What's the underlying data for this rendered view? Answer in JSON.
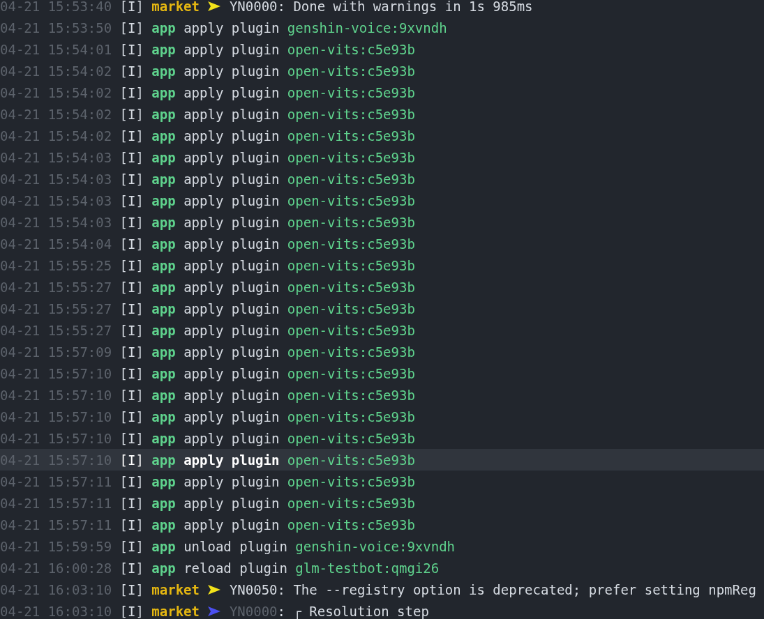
{
  "log": [
    {
      "kind": "market",
      "time": "04-21 15:53:40",
      "level": "[I]",
      "module": "market",
      "color": "#f2e21a",
      "code_muted": false,
      "code": "YN0000",
      "message": ": Done with warnings in 1s 985ms",
      "selected": false
    },
    {
      "kind": "plugin",
      "time": "04-21 15:53:50",
      "level": "[I]",
      "module": "app",
      "action": "apply plugin",
      "plugin": "genshin-voice:9xvndh",
      "selected": false
    },
    {
      "kind": "plugin",
      "time": "04-21 15:54:01",
      "level": "[I]",
      "module": "app",
      "action": "apply plugin",
      "plugin": "open-vits:c5e93b",
      "selected": false
    },
    {
      "kind": "plugin",
      "time": "04-21 15:54:02",
      "level": "[I]",
      "module": "app",
      "action": "apply plugin",
      "plugin": "open-vits:c5e93b",
      "selected": false
    },
    {
      "kind": "plugin",
      "time": "04-21 15:54:02",
      "level": "[I]",
      "module": "app",
      "action": "apply plugin",
      "plugin": "open-vits:c5e93b",
      "selected": false
    },
    {
      "kind": "plugin",
      "time": "04-21 15:54:02",
      "level": "[I]",
      "module": "app",
      "action": "apply plugin",
      "plugin": "open-vits:c5e93b",
      "selected": false
    },
    {
      "kind": "plugin",
      "time": "04-21 15:54:02",
      "level": "[I]",
      "module": "app",
      "action": "apply plugin",
      "plugin": "open-vits:c5e93b",
      "selected": false
    },
    {
      "kind": "plugin",
      "time": "04-21 15:54:03",
      "level": "[I]",
      "module": "app",
      "action": "apply plugin",
      "plugin": "open-vits:c5e93b",
      "selected": false
    },
    {
      "kind": "plugin",
      "time": "04-21 15:54:03",
      "level": "[I]",
      "module": "app",
      "action": "apply plugin",
      "plugin": "open-vits:c5e93b",
      "selected": false
    },
    {
      "kind": "plugin",
      "time": "04-21 15:54:03",
      "level": "[I]",
      "module": "app",
      "action": "apply plugin",
      "plugin": "open-vits:c5e93b",
      "selected": false
    },
    {
      "kind": "plugin",
      "time": "04-21 15:54:03",
      "level": "[I]",
      "module": "app",
      "action": "apply plugin",
      "plugin": "open-vits:c5e93b",
      "selected": false
    },
    {
      "kind": "plugin",
      "time": "04-21 15:54:04",
      "level": "[I]",
      "module": "app",
      "action": "apply plugin",
      "plugin": "open-vits:c5e93b",
      "selected": false
    },
    {
      "kind": "plugin",
      "time": "04-21 15:55:25",
      "level": "[I]",
      "module": "app",
      "action": "apply plugin",
      "plugin": "open-vits:c5e93b",
      "selected": false
    },
    {
      "kind": "plugin",
      "time": "04-21 15:55:27",
      "level": "[I]",
      "module": "app",
      "action": "apply plugin",
      "plugin": "open-vits:c5e93b",
      "selected": false
    },
    {
      "kind": "plugin",
      "time": "04-21 15:55:27",
      "level": "[I]",
      "module": "app",
      "action": "apply plugin",
      "plugin": "open-vits:c5e93b",
      "selected": false
    },
    {
      "kind": "plugin",
      "time": "04-21 15:55:27",
      "level": "[I]",
      "module": "app",
      "action": "apply plugin",
      "plugin": "open-vits:c5e93b",
      "selected": false
    },
    {
      "kind": "plugin",
      "time": "04-21 15:57:09",
      "level": "[I]",
      "module": "app",
      "action": "apply plugin",
      "plugin": "open-vits:c5e93b",
      "selected": false
    },
    {
      "kind": "plugin",
      "time": "04-21 15:57:10",
      "level": "[I]",
      "module": "app",
      "action": "apply plugin",
      "plugin": "open-vits:c5e93b",
      "selected": false
    },
    {
      "kind": "plugin",
      "time": "04-21 15:57:10",
      "level": "[I]",
      "module": "app",
      "action": "apply plugin",
      "plugin": "open-vits:c5e93b",
      "selected": false
    },
    {
      "kind": "plugin",
      "time": "04-21 15:57:10",
      "level": "[I]",
      "module": "app",
      "action": "apply plugin",
      "plugin": "open-vits:c5e93b",
      "selected": false
    },
    {
      "kind": "plugin",
      "time": "04-21 15:57:10",
      "level": "[I]",
      "module": "app",
      "action": "apply plugin",
      "plugin": "open-vits:c5e93b",
      "selected": false
    },
    {
      "kind": "plugin",
      "time": "04-21 15:57:10",
      "level": "[I]",
      "module": "app",
      "action": "apply plugin",
      "plugin": "open-vits:c5e93b",
      "selected": true
    },
    {
      "kind": "plugin",
      "time": "04-21 15:57:11",
      "level": "[I]",
      "module": "app",
      "action": "apply plugin",
      "plugin": "open-vits:c5e93b",
      "selected": false
    },
    {
      "kind": "plugin",
      "time": "04-21 15:57:11",
      "level": "[I]",
      "module": "app",
      "action": "apply plugin",
      "plugin": "open-vits:c5e93b",
      "selected": false
    },
    {
      "kind": "plugin",
      "time": "04-21 15:57:11",
      "level": "[I]",
      "module": "app",
      "action": "apply plugin",
      "plugin": "open-vits:c5e93b",
      "selected": false
    },
    {
      "kind": "plugin",
      "time": "04-21 15:59:59",
      "level": "[I]",
      "module": "app",
      "action": "unload plugin",
      "plugin": "genshin-voice:9xvndh",
      "selected": false
    },
    {
      "kind": "plugin",
      "time": "04-21 16:00:28",
      "level": "[I]",
      "module": "app",
      "action": "reload plugin",
      "plugin": "glm-testbot:qmgi26",
      "selected": false
    },
    {
      "kind": "market",
      "time": "04-21 16:03:10",
      "level": "[I]",
      "module": "market",
      "color": "#f2e21a",
      "code_muted": false,
      "code": "YN0050",
      "message": ": The --registry option is deprecated; prefer setting npmReg",
      "selected": false
    },
    {
      "kind": "market",
      "time": "04-21 16:03:10",
      "level": "[I]",
      "module": "market",
      "color": "#4b4ff0",
      "code_muted": true,
      "code": "YN0000",
      "message": ": ┌ Resolution step",
      "selected": false
    }
  ]
}
